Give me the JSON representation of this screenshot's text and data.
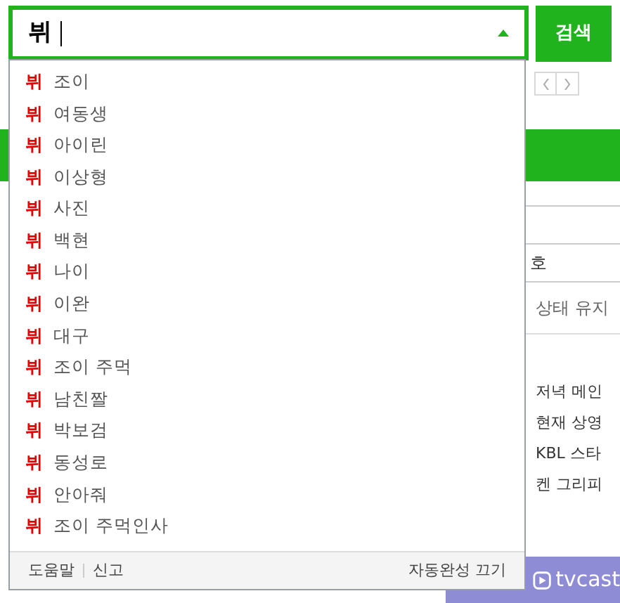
{
  "search": {
    "value": "뷔",
    "button": "검색"
  },
  "suggestions": {
    "items": [
      {
        "prefix": "뷔",
        "text": "조이"
      },
      {
        "prefix": "뷔",
        "text": "여동생"
      },
      {
        "prefix": "뷔",
        "text": "아이린"
      },
      {
        "prefix": "뷔",
        "text": "이상형"
      },
      {
        "prefix": "뷔",
        "text": "사진"
      },
      {
        "prefix": "뷔",
        "text": "백현"
      },
      {
        "prefix": "뷔",
        "text": "나이"
      },
      {
        "prefix": "뷔",
        "text": "이완"
      },
      {
        "prefix": "뷔",
        "text": "대구"
      },
      {
        "prefix": "뷔",
        "text": "조이 주먹"
      },
      {
        "prefix": "뷔",
        "text": "남친짤"
      },
      {
        "prefix": "뷔",
        "text": "박보검"
      },
      {
        "prefix": "뷔",
        "text": "동성로"
      },
      {
        "prefix": "뷔",
        "text": "안아줘"
      },
      {
        "prefix": "뷔",
        "text": "조이 주먹인사"
      }
    ],
    "footer_links": [
      "도움말",
      "신고"
    ],
    "autocomplete_off": "자동완성 끄기"
  },
  "background": {
    "login_texts": [
      "호",
      "상태 유지"
    ],
    "news": [
      "저녁 메인",
      "현재 상영",
      "KBL 스타",
      "켄 그리피"
    ],
    "video_logo": "tvcast"
  }
}
